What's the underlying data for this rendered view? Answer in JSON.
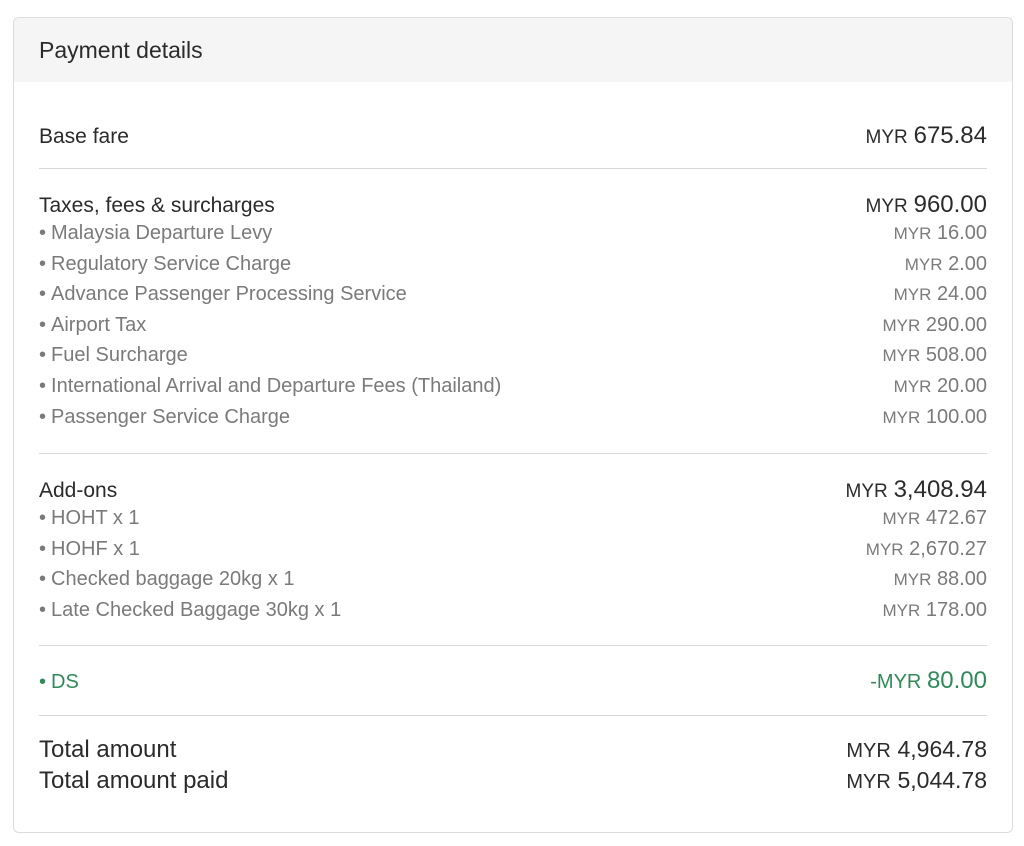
{
  "header": {
    "title": "Payment details"
  },
  "base_fare": {
    "label": "Base fare",
    "currency": "MYR",
    "amount": "675.84"
  },
  "taxes": {
    "label": "Taxes, fees & surcharges",
    "currency": "MYR",
    "amount": "960.00",
    "items": [
      {
        "label": "Malaysia Departure Levy",
        "currency": "MYR",
        "amount": "16.00"
      },
      {
        "label": "Regulatory Service Charge",
        "currency": "MYR",
        "amount": "2.00"
      },
      {
        "label": "Advance Passenger Processing Service",
        "currency": "MYR",
        "amount": "24.00"
      },
      {
        "label": "Airport Tax",
        "currency": "MYR",
        "amount": "290.00"
      },
      {
        "label": "Fuel Surcharge",
        "currency": "MYR",
        "amount": "508.00"
      },
      {
        "label": "International Arrival and Departure Fees (Thailand)",
        "currency": "MYR",
        "amount": "20.00"
      },
      {
        "label": "Passenger Service Charge",
        "currency": "MYR",
        "amount": "100.00"
      }
    ]
  },
  "addons": {
    "label": "Add-ons",
    "currency": "MYR",
    "amount": "3,408.94",
    "items": [
      {
        "label": "HOHT x 1",
        "currency": "MYR",
        "amount": "472.67"
      },
      {
        "label": "HOHF x 1",
        "currency": "MYR",
        "amount": "2,670.27"
      },
      {
        "label": "Checked baggage 20kg x 1",
        "currency": "MYR",
        "amount": "88.00"
      },
      {
        "label": "Late Checked Baggage 30kg x 1",
        "currency": "MYR",
        "amount": "178.00"
      }
    ]
  },
  "discount": {
    "label": "DS",
    "currency": "-MYR",
    "amount": "80.00",
    "color": "#2e8b57"
  },
  "totals": {
    "total": {
      "label": "Total amount",
      "currency": "MYR",
      "amount": "4,964.78"
    },
    "paid": {
      "label": "Total amount paid",
      "currency": "MYR",
      "amount": "5,044.78"
    }
  },
  "bullet": "•"
}
